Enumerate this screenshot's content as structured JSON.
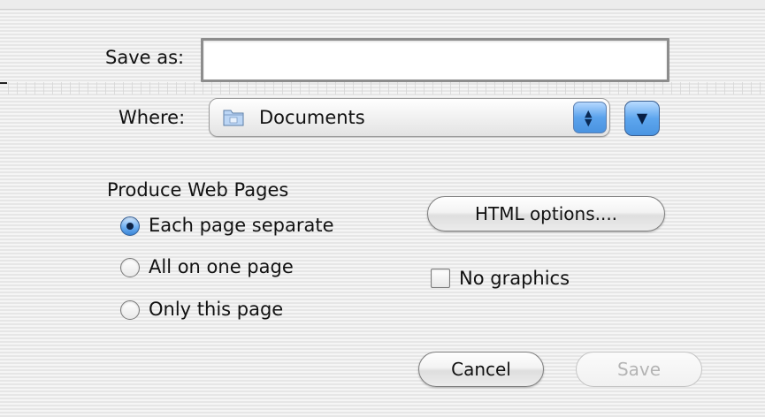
{
  "save_as": {
    "label": "Save as:",
    "value": ""
  },
  "where": {
    "label": "Where:",
    "selected": "Documents",
    "icon": "folder-icon"
  },
  "produce": {
    "heading": "Produce Web Pages",
    "options": [
      {
        "label": "Each page separate",
        "checked": true
      },
      {
        "label": "All on one page",
        "checked": false
      },
      {
        "label": "Only this page",
        "checked": false
      }
    ]
  },
  "html_options": {
    "label": "HTML options...."
  },
  "no_graphics": {
    "label": "No graphics",
    "checked": false
  },
  "buttons": {
    "cancel": "Cancel",
    "save": "Save",
    "save_enabled": false
  },
  "colors": {
    "accent": "#5aa2ec",
    "background": "#f2f2f2"
  }
}
